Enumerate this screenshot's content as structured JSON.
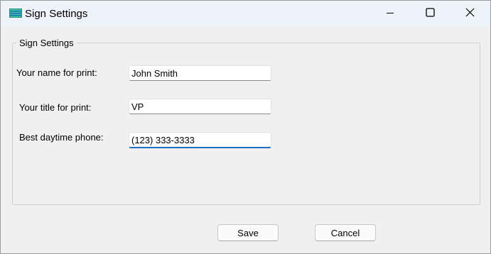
{
  "window": {
    "title": "Sign Settings",
    "app_icon": "app-icon",
    "controls": {
      "minimize_icon": "minimize-icon",
      "maximize_icon": "maximize-icon",
      "close_icon": "close-icon"
    }
  },
  "group": {
    "legend": "Sign Settings",
    "fields": [
      {
        "label": "Your name for print:",
        "value": "John Smith"
      },
      {
        "label": "Your title for print:",
        "value": "VP"
      },
      {
        "label": "Best daytime phone:",
        "value": "(123) 333-3333"
      }
    ]
  },
  "buttons": {
    "save_label": "Save",
    "cancel_label": "Cancel"
  },
  "colors": {
    "titlebar": "#eef2f9",
    "window_bg": "#f0f0f0",
    "focus_accent": "#1f6fc5"
  }
}
